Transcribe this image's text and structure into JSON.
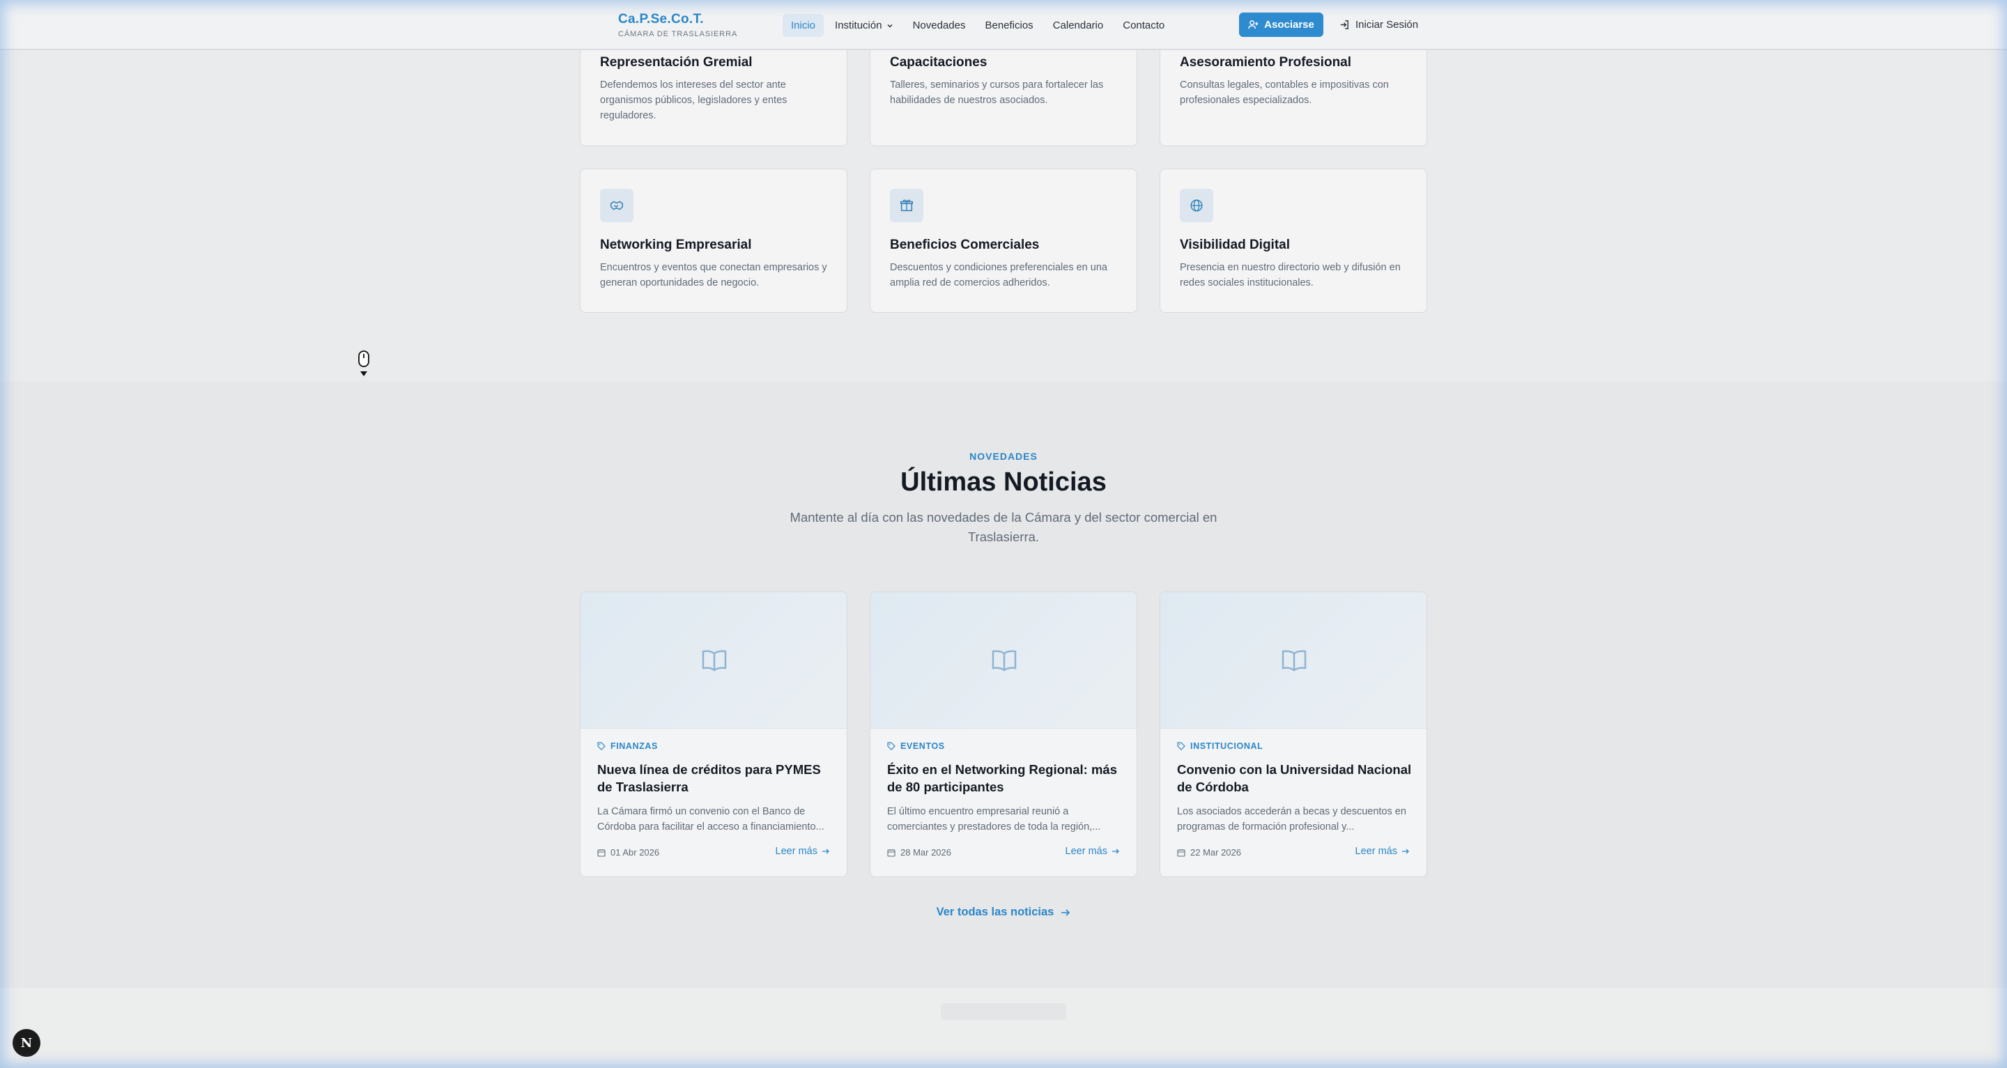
{
  "header": {
    "brand_name": "Ca.P.Se.Co.T.",
    "brand_sub": "CÁMARA DE TRASLASIERRA",
    "nav": [
      "Inicio",
      "Institución",
      "Novedades",
      "Beneficios",
      "Calendario",
      "Contacto"
    ],
    "join_label": "Asociarse",
    "login_label": "Iniciar Sesión"
  },
  "services": [
    {
      "title": "Representación Gremial",
      "desc": "Defendemos los intereses del sector ante organismos públicos, legisladores y entes reguladores."
    },
    {
      "title": "Capacitaciones",
      "desc": "Talleres, seminarios y cursos para fortalecer las habilidades de nuestros asociados."
    },
    {
      "title": "Asesoramiento Profesional",
      "desc": "Consultas legales, contables e impositivas con profesionales especializados."
    },
    {
      "title": "Networking Empresarial",
      "desc": "Encuentros y eventos que conectan empresarios y generan oportunidades de negocio.",
      "icon": "handshake-icon"
    },
    {
      "title": "Beneficios Comerciales",
      "desc": "Descuentos y condiciones preferenciales en una amplia red de comercios adheridos.",
      "icon": "gift-icon"
    },
    {
      "title": "Visibilidad Digital",
      "desc": "Presencia en nuestro directorio web y difusión en redes sociales institucionales.",
      "icon": "globe-icon"
    }
  ],
  "news_section": {
    "eyebrow": "NOVEDADES",
    "title": "Últimas Noticias",
    "subtitle": "Mantente al día con las novedades de la Cámara y del sector comercial en Traslasierra.",
    "all_news_label": "Ver todas las noticias",
    "articles": [
      {
        "category": "FINANZAS",
        "title": "Nueva línea de créditos para PYMES de Traslasierra",
        "excerpt": "La Cámara firmó un convenio con el Banco de Córdoba para facilitar el acceso a financiamiento...",
        "date": "01 Abr 2026",
        "more": "Leer más"
      },
      {
        "category": "EVENTOS",
        "title": "Éxito en el Networking Regional: más de 80 participantes",
        "excerpt": "El último encuentro empresarial reunió a comerciantes y prestadores de toda la región,...",
        "date": "28 Mar 2026",
        "more": "Leer más"
      },
      {
        "category": "INSTITUCIONAL",
        "title": "Convenio con la Universidad Nacional de Córdoba",
        "excerpt": "Los asociados accederán a becas y descuentos en programas de formación profesional y...",
        "date": "22 Mar 2026",
        "more": "Leer más"
      }
    ]
  },
  "colors": {
    "accent": "#2a86c9",
    "primary_button": "#2e8bd0",
    "background": "#eaebec"
  },
  "dev_badge": "N"
}
